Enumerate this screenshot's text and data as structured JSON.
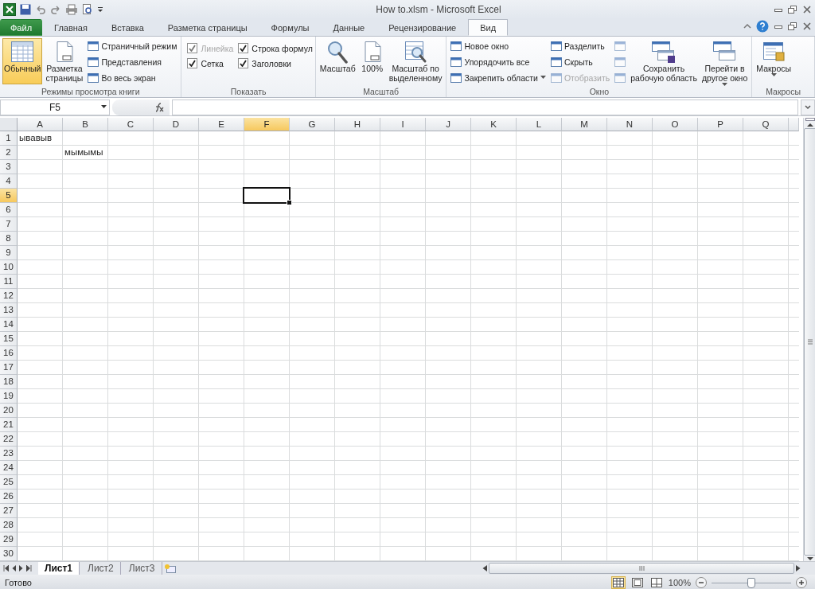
{
  "title_bar": {
    "title": "How to.xlsm  -  Microsoft Excel"
  },
  "tabs": [
    {
      "label": "Файл",
      "kind": "file",
      "selected": false
    },
    {
      "label": "Главная",
      "kind": "tab",
      "selected": false
    },
    {
      "label": "Вставка",
      "kind": "tab",
      "selected": false
    },
    {
      "label": "Разметка страницы",
      "kind": "tab",
      "selected": false
    },
    {
      "label": "Формулы",
      "kind": "tab",
      "selected": false
    },
    {
      "label": "Данные",
      "kind": "tab",
      "selected": false
    },
    {
      "label": "Рецензирование",
      "kind": "tab",
      "selected": false
    },
    {
      "label": "Вид",
      "kind": "tab",
      "selected": true
    }
  ],
  "ribbon": {
    "groups": [
      {
        "label": "Режимы просмотра книги",
        "columns": [
          [
            {
              "kind": "large",
              "label": "Обычный",
              "selected": true
            }
          ],
          [
            {
              "kind": "large",
              "label": "Разметка\nстраницы",
              "selected": false
            }
          ],
          [
            {
              "kind": "small",
              "label": "Страничный режим"
            },
            {
              "kind": "small",
              "label": "Представления"
            },
            {
              "kind": "small",
              "label": "Во весь экран"
            }
          ]
        ]
      },
      {
        "label": "Показать",
        "columns": [
          [
            {
              "kind": "check",
              "label": "Линейка",
              "checked": true,
              "disabled": true
            },
            {
              "kind": "check",
              "label": "Сетка",
              "checked": true,
              "disabled": false
            }
          ],
          [
            {
              "kind": "check",
              "label": "Строка формул",
              "checked": true,
              "disabled": false
            },
            {
              "kind": "check",
              "label": "Заголовки",
              "checked": true,
              "disabled": false
            }
          ]
        ]
      },
      {
        "label": "Масштаб",
        "columns": [
          [
            {
              "kind": "large",
              "label": "Масштаб"
            }
          ],
          [
            {
              "kind": "large",
              "label": "100%"
            }
          ],
          [
            {
              "kind": "large",
              "label": "Масштаб по\nвыделенному"
            }
          ]
        ]
      },
      {
        "label": "Окно",
        "columns": [
          [
            {
              "kind": "small",
              "label": "Новое окно"
            },
            {
              "kind": "small",
              "label": "Упорядочить все"
            },
            {
              "kind": "small",
              "label": "Закрепить области",
              "dropdown": true
            }
          ],
          [
            {
              "kind": "small",
              "label": "Разделить"
            },
            {
              "kind": "small",
              "label": "Скрыть"
            },
            {
              "kind": "small",
              "label": "Отобразить",
              "disabled": true
            }
          ],
          [
            {
              "kind": "mini",
              "disabled": true
            },
            {
              "kind": "mini",
              "disabled": true
            },
            {
              "kind": "mini",
              "disabled": true
            }
          ],
          [
            {
              "kind": "large",
              "label": "Сохранить\nрабочую область"
            }
          ],
          [
            {
              "kind": "large",
              "label": "Перейти в\nдругое окно",
              "dropdown": true
            }
          ]
        ]
      },
      {
        "label": "Макросы",
        "columns": [
          [
            {
              "kind": "large",
              "label": "Макросы",
              "dropdown": true
            }
          ]
        ]
      }
    ]
  },
  "formula_bar": {
    "name_box": "F5"
  },
  "columns": [
    {
      "label": "A",
      "selected": false
    },
    {
      "label": "B",
      "selected": false
    },
    {
      "label": "C",
      "selected": false
    },
    {
      "label": "D",
      "selected": false
    },
    {
      "label": "E",
      "selected": false
    },
    {
      "label": "F",
      "selected": true
    },
    {
      "label": "G",
      "selected": false
    },
    {
      "label": "H",
      "selected": false
    },
    {
      "label": "I",
      "selected": false
    },
    {
      "label": "J",
      "selected": false
    },
    {
      "label": "K",
      "selected": false
    },
    {
      "label": "L",
      "selected": false
    },
    {
      "label": "M",
      "selected": false
    },
    {
      "label": "N",
      "selected": false
    },
    {
      "label": "O",
      "selected": false
    },
    {
      "label": "P",
      "selected": false
    },
    {
      "label": "Q",
      "selected": false
    }
  ],
  "rows": [
    {
      "label": "1",
      "selected": false,
      "cells": [
        {
          "text": "ывавыв"
        }
      ]
    },
    {
      "label": "2",
      "selected": false,
      "cells": [
        {},
        {
          "text": "мымымы"
        }
      ]
    },
    {
      "label": "3",
      "selected": false
    },
    {
      "label": "4",
      "selected": false
    },
    {
      "label": "5",
      "selected": true
    },
    {
      "label": "6",
      "selected": false
    },
    {
      "label": "7",
      "selected": false
    },
    {
      "label": "8",
      "selected": false
    },
    {
      "label": "9",
      "selected": false
    },
    {
      "label": "10",
      "selected": false
    },
    {
      "label": "11",
      "selected": false
    },
    {
      "label": "12",
      "selected": false
    },
    {
      "label": "13",
      "selected": false
    },
    {
      "label": "14",
      "selected": false
    },
    {
      "label": "15",
      "selected": false
    },
    {
      "label": "16",
      "selected": false
    },
    {
      "label": "17",
      "selected": false
    },
    {
      "label": "18",
      "selected": false
    },
    {
      "label": "19",
      "selected": false
    },
    {
      "label": "20",
      "selected": false
    },
    {
      "label": "21",
      "selected": false
    },
    {
      "label": "22",
      "selected": false
    },
    {
      "label": "23",
      "selected": false
    },
    {
      "label": "24",
      "selected": false
    },
    {
      "label": "25",
      "selected": false
    },
    {
      "label": "26",
      "selected": false
    },
    {
      "label": "27",
      "selected": false
    },
    {
      "label": "28",
      "selected": false
    },
    {
      "label": "29",
      "selected": false
    },
    {
      "label": "30",
      "selected": false
    }
  ],
  "sheet_tabs": [
    {
      "label": "Лист1",
      "selected": true
    },
    {
      "label": "Лист2",
      "selected": false
    },
    {
      "label": "Лист3",
      "selected": false
    }
  ],
  "status_bar": {
    "status": "Готово",
    "views": [
      {
        "kind": "normal",
        "selected": true
      },
      {
        "kind": "layout",
        "selected": false
      },
      {
        "kind": "page_break",
        "selected": false
      }
    ],
    "zoom": "100%",
    "zoom_slider": {
      "level": 0.5
    }
  }
}
